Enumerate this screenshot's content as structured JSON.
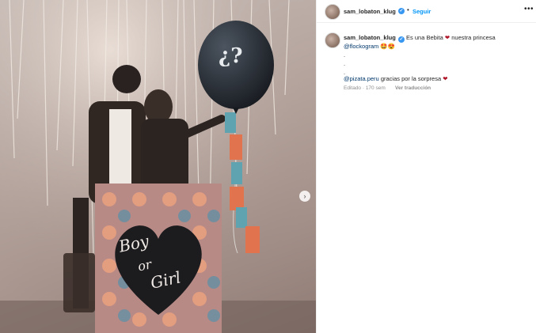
{
  "post": {
    "username": "sam_lobaton_klug",
    "follow_label": "Seguir",
    "more_label": "•••",
    "caption": {
      "line1_text": "Es una Bebita",
      "heart": "❤",
      "line1_tail": "nuestra princesa",
      "mention1": "@flockogram",
      "emojis1": "🤩😍",
      "dot_lines": [
        ".",
        ".",
        "."
      ],
      "mention2": "@pizata.peru",
      "line_last": "gracias por la sorpresa",
      "heart2": "❤"
    },
    "edited_label": "Editado · 170 sem",
    "translation_label": "Ver traducción"
  },
  "photo": {
    "box_text_1": "Boy",
    "box_text_2": "or",
    "box_text_3": "Girl",
    "balloon_text": "¿?",
    "next_label": "›"
  }
}
